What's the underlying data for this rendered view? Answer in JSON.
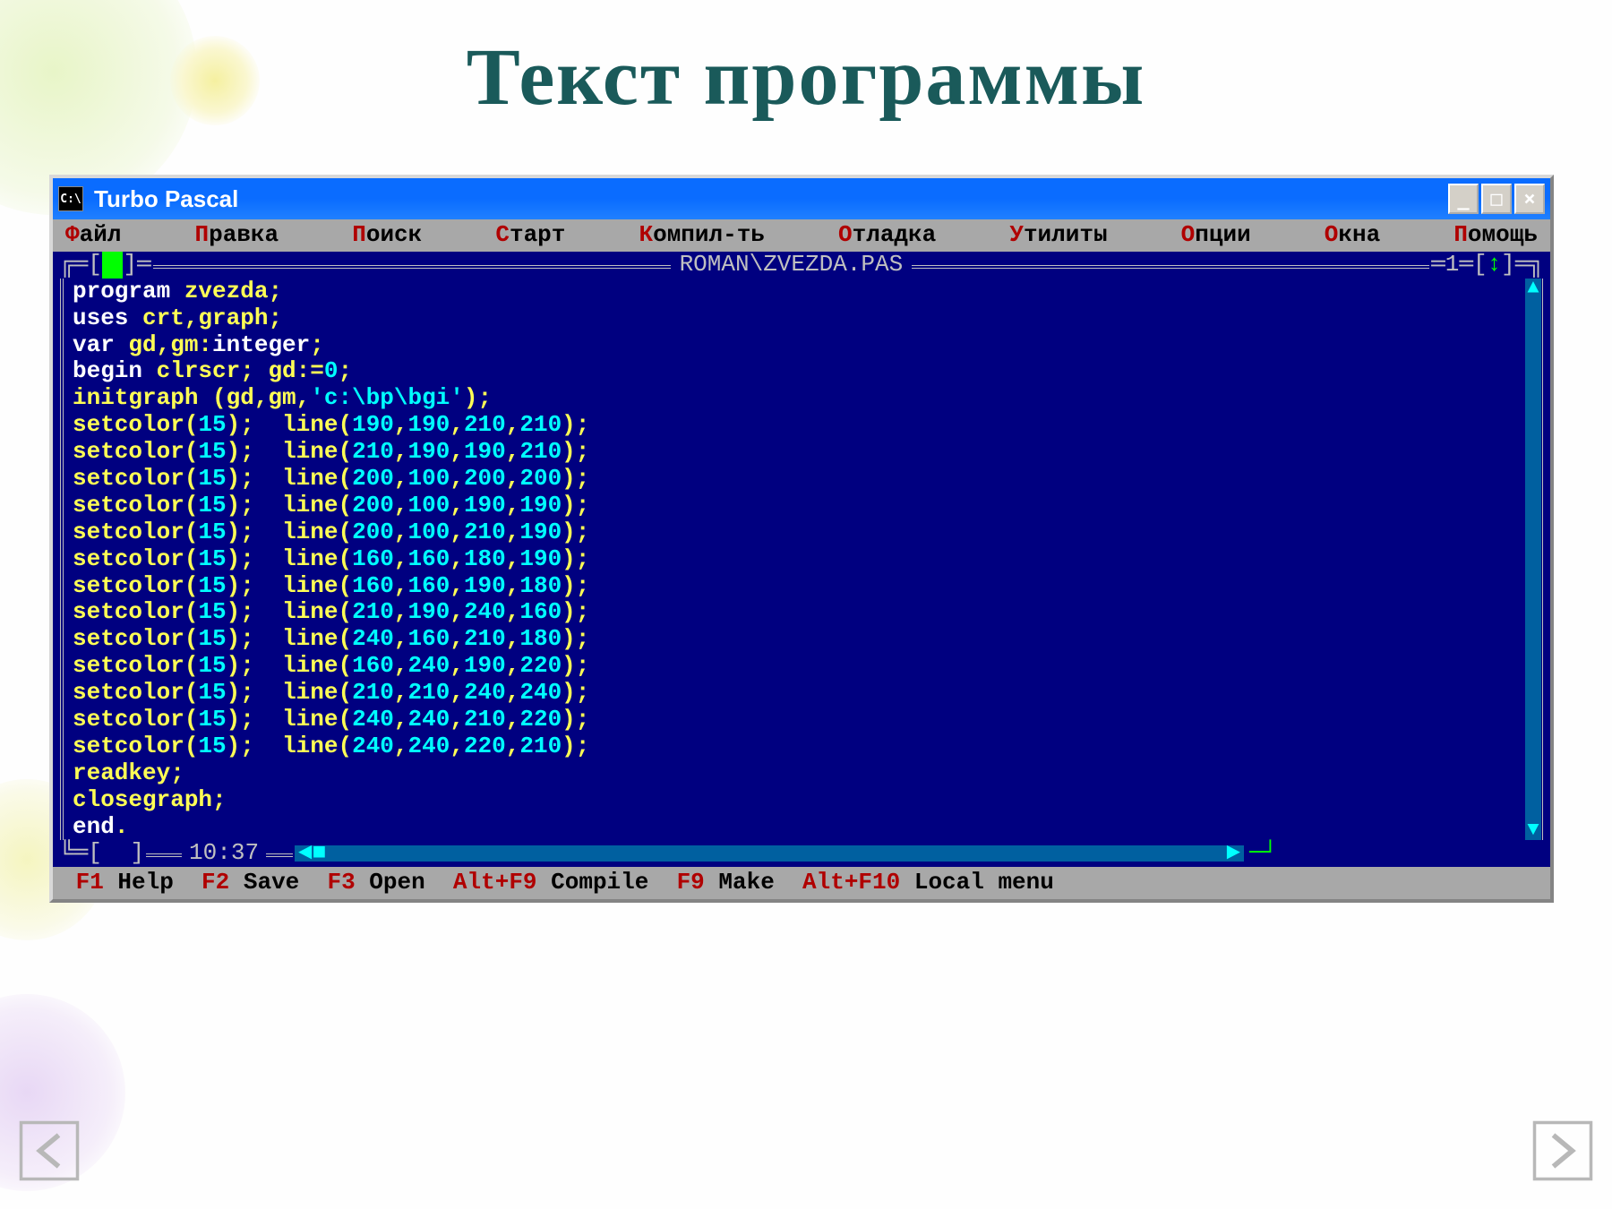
{
  "page_title": "Текст программы",
  "window": {
    "icon_text": "C:\\",
    "title": "Turbo Pascal",
    "buttons": {
      "min": "_",
      "max": "□",
      "close": "×"
    }
  },
  "menubar": [
    {
      "hot": "Ф",
      "rest": "айл"
    },
    {
      "hot": "П",
      "rest": "равка"
    },
    {
      "hot": "П",
      "rest": "оиск"
    },
    {
      "hot": "С",
      "rest": "тарт"
    },
    {
      "hot": "К",
      "rest": "омпил-ть"
    },
    {
      "hot": "О",
      "rest": "тладка"
    },
    {
      "hot": "У",
      "rest": "тилиты"
    },
    {
      "hot": "О",
      "rest": "пции"
    },
    {
      "hot": "О",
      "rest": "кна"
    },
    {
      "hot": "П",
      "rest": "омощь"
    }
  ],
  "frame": {
    "left_marker_open": "═[",
    "left_marker_close": "]═",
    "filename": "ROMAN\\ZVEZDA.PAS",
    "right_segment": "═1═[",
    "right_arrow": "↕",
    "right_close": "]═",
    "clock_label": "10:37",
    "bottom_left_open": "═[",
    "bottom_left_close": "]"
  },
  "code_lines": [
    [
      {
        "t": "program ",
        "c": "kw"
      },
      {
        "t": "zvezda;",
        "c": "id"
      }
    ],
    [
      {
        "t": "uses ",
        "c": "kw"
      },
      {
        "t": "crt,graph;",
        "c": "id"
      }
    ],
    [
      {
        "t": "var ",
        "c": "kw"
      },
      {
        "t": "gd,gm:",
        "c": "id"
      },
      {
        "t": "integer",
        "c": "kw"
      },
      {
        "t": ";",
        "c": "id"
      }
    ],
    [
      {
        "t": "begin ",
        "c": "kw"
      },
      {
        "t": "clrscr; gd:=",
        "c": "id"
      },
      {
        "t": "0",
        "c": "num"
      },
      {
        "t": ";",
        "c": "id"
      }
    ],
    [
      {
        "t": "initgraph (gd,gm,",
        "c": "id"
      },
      {
        "t": "'c:\\bp\\bgi'",
        "c": "str"
      },
      {
        "t": ");",
        "c": "id"
      }
    ],
    [
      {
        "t": "setcolor(",
        "c": "id"
      },
      {
        "t": "15",
        "c": "num"
      },
      {
        "t": ");  line(",
        "c": "id"
      },
      {
        "t": "190",
        "c": "num"
      },
      {
        "t": ",",
        "c": "id"
      },
      {
        "t": "190",
        "c": "num"
      },
      {
        "t": ",",
        "c": "id"
      },
      {
        "t": "210",
        "c": "num"
      },
      {
        "t": ",",
        "c": "id"
      },
      {
        "t": "210",
        "c": "num"
      },
      {
        "t": ");",
        "c": "id"
      }
    ],
    [
      {
        "t": "setcolor(",
        "c": "id"
      },
      {
        "t": "15",
        "c": "num"
      },
      {
        "t": ");  line(",
        "c": "id"
      },
      {
        "t": "210",
        "c": "num"
      },
      {
        "t": ",",
        "c": "id"
      },
      {
        "t": "190",
        "c": "num"
      },
      {
        "t": ",",
        "c": "id"
      },
      {
        "t": "190",
        "c": "num"
      },
      {
        "t": ",",
        "c": "id"
      },
      {
        "t": "210",
        "c": "num"
      },
      {
        "t": ");",
        "c": "id"
      }
    ],
    [
      {
        "t": "setcolor(",
        "c": "id"
      },
      {
        "t": "15",
        "c": "num"
      },
      {
        "t": ");  line(",
        "c": "id"
      },
      {
        "t": "200",
        "c": "num"
      },
      {
        "t": ",",
        "c": "id"
      },
      {
        "t": "100",
        "c": "num"
      },
      {
        "t": ",",
        "c": "id"
      },
      {
        "t": "200",
        "c": "num"
      },
      {
        "t": ",",
        "c": "id"
      },
      {
        "t": "200",
        "c": "num"
      },
      {
        "t": ");",
        "c": "id"
      }
    ],
    [
      {
        "t": "setcolor(",
        "c": "id"
      },
      {
        "t": "15",
        "c": "num"
      },
      {
        "t": ");  line(",
        "c": "id"
      },
      {
        "t": "200",
        "c": "num"
      },
      {
        "t": ",",
        "c": "id"
      },
      {
        "t": "100",
        "c": "num"
      },
      {
        "t": ",",
        "c": "id"
      },
      {
        "t": "190",
        "c": "num"
      },
      {
        "t": ",",
        "c": "id"
      },
      {
        "t": "190",
        "c": "num"
      },
      {
        "t": ");",
        "c": "id"
      }
    ],
    [
      {
        "t": "setcolor(",
        "c": "id"
      },
      {
        "t": "15",
        "c": "num"
      },
      {
        "t": ");  line(",
        "c": "id"
      },
      {
        "t": "200",
        "c": "num"
      },
      {
        "t": ",",
        "c": "id"
      },
      {
        "t": "100",
        "c": "num"
      },
      {
        "t": ",",
        "c": "id"
      },
      {
        "t": "210",
        "c": "num"
      },
      {
        "t": ",",
        "c": "id"
      },
      {
        "t": "190",
        "c": "num"
      },
      {
        "t": ");",
        "c": "id"
      }
    ],
    [
      {
        "t": "setcolor(",
        "c": "id"
      },
      {
        "t": "15",
        "c": "num"
      },
      {
        "t": ");  line(",
        "c": "id"
      },
      {
        "t": "160",
        "c": "num"
      },
      {
        "t": ",",
        "c": "id"
      },
      {
        "t": "160",
        "c": "num"
      },
      {
        "t": ",",
        "c": "id"
      },
      {
        "t": "180",
        "c": "num"
      },
      {
        "t": ",",
        "c": "id"
      },
      {
        "t": "190",
        "c": "num"
      },
      {
        "t": ");",
        "c": "id"
      }
    ],
    [
      {
        "t": "setcolor(",
        "c": "id"
      },
      {
        "t": "15",
        "c": "num"
      },
      {
        "t": ");  line(",
        "c": "id"
      },
      {
        "t": "160",
        "c": "num"
      },
      {
        "t": ",",
        "c": "id"
      },
      {
        "t": "160",
        "c": "num"
      },
      {
        "t": ",",
        "c": "id"
      },
      {
        "t": "190",
        "c": "num"
      },
      {
        "t": ",",
        "c": "id"
      },
      {
        "t": "180",
        "c": "num"
      },
      {
        "t": ");",
        "c": "id"
      }
    ],
    [
      {
        "t": "setcolor(",
        "c": "id"
      },
      {
        "t": "15",
        "c": "num"
      },
      {
        "t": ");  line(",
        "c": "id"
      },
      {
        "t": "210",
        "c": "num"
      },
      {
        "t": ",",
        "c": "id"
      },
      {
        "t": "190",
        "c": "num"
      },
      {
        "t": ",",
        "c": "id"
      },
      {
        "t": "240",
        "c": "num"
      },
      {
        "t": ",",
        "c": "id"
      },
      {
        "t": "160",
        "c": "num"
      },
      {
        "t": ");",
        "c": "id"
      }
    ],
    [
      {
        "t": "setcolor(",
        "c": "id"
      },
      {
        "t": "15",
        "c": "num"
      },
      {
        "t": ");  line(",
        "c": "id"
      },
      {
        "t": "240",
        "c": "num"
      },
      {
        "t": ",",
        "c": "id"
      },
      {
        "t": "160",
        "c": "num"
      },
      {
        "t": ",",
        "c": "id"
      },
      {
        "t": "210",
        "c": "num"
      },
      {
        "t": ",",
        "c": "id"
      },
      {
        "t": "180",
        "c": "num"
      },
      {
        "t": ");",
        "c": "id"
      }
    ],
    [
      {
        "t": "setcolor(",
        "c": "id"
      },
      {
        "t": "15",
        "c": "num"
      },
      {
        "t": ");  line(",
        "c": "id"
      },
      {
        "t": "160",
        "c": "num"
      },
      {
        "t": ",",
        "c": "id"
      },
      {
        "t": "240",
        "c": "num"
      },
      {
        "t": ",",
        "c": "id"
      },
      {
        "t": "190",
        "c": "num"
      },
      {
        "t": ",",
        "c": "id"
      },
      {
        "t": "220",
        "c": "num"
      },
      {
        "t": ");",
        "c": "id"
      }
    ],
    [
      {
        "t": "setcolor(",
        "c": "id"
      },
      {
        "t": "15",
        "c": "num"
      },
      {
        "t": ");  line(",
        "c": "id"
      },
      {
        "t": "210",
        "c": "num"
      },
      {
        "t": ",",
        "c": "id"
      },
      {
        "t": "210",
        "c": "num"
      },
      {
        "t": ",",
        "c": "id"
      },
      {
        "t": "240",
        "c": "num"
      },
      {
        "t": ",",
        "c": "id"
      },
      {
        "t": "240",
        "c": "num"
      },
      {
        "t": ");",
        "c": "id"
      }
    ],
    [
      {
        "t": "setcolor(",
        "c": "id"
      },
      {
        "t": "15",
        "c": "num"
      },
      {
        "t": ");  line(",
        "c": "id"
      },
      {
        "t": "240",
        "c": "num"
      },
      {
        "t": ",",
        "c": "id"
      },
      {
        "t": "240",
        "c": "num"
      },
      {
        "t": ",",
        "c": "id"
      },
      {
        "t": "210",
        "c": "num"
      },
      {
        "t": ",",
        "c": "id"
      },
      {
        "t": "220",
        "c": "num"
      },
      {
        "t": ");",
        "c": "id"
      }
    ],
    [
      {
        "t": "setcolor(",
        "c": "id"
      },
      {
        "t": "15",
        "c": "num"
      },
      {
        "t": ");  line(",
        "c": "id"
      },
      {
        "t": "240",
        "c": "num"
      },
      {
        "t": ",",
        "c": "id"
      },
      {
        "t": "240",
        "c": "num"
      },
      {
        "t": ",",
        "c": "id"
      },
      {
        "t": "220",
        "c": "num"
      },
      {
        "t": ",",
        "c": "id"
      },
      {
        "t": "210",
        "c": "num"
      },
      {
        "t": ");",
        "c": "id"
      }
    ],
    [
      {
        "t": "readkey;",
        "c": "id"
      }
    ],
    [
      {
        "t": "closegraph;",
        "c": "id"
      }
    ],
    [
      {
        "t": "end",
        "c": "kw"
      },
      {
        "t": ".",
        "c": "id"
      }
    ]
  ],
  "statusbar": [
    {
      "k": "F1",
      "l": " Help  "
    },
    {
      "k": "F2",
      "l": " Save  "
    },
    {
      "k": "F3",
      "l": " Open  "
    },
    {
      "k": "Alt+F9",
      "l": " Compile  "
    },
    {
      "k": "F9",
      "l": " Make  "
    },
    {
      "k": "Alt+F10",
      "l": " Local menu"
    }
  ]
}
